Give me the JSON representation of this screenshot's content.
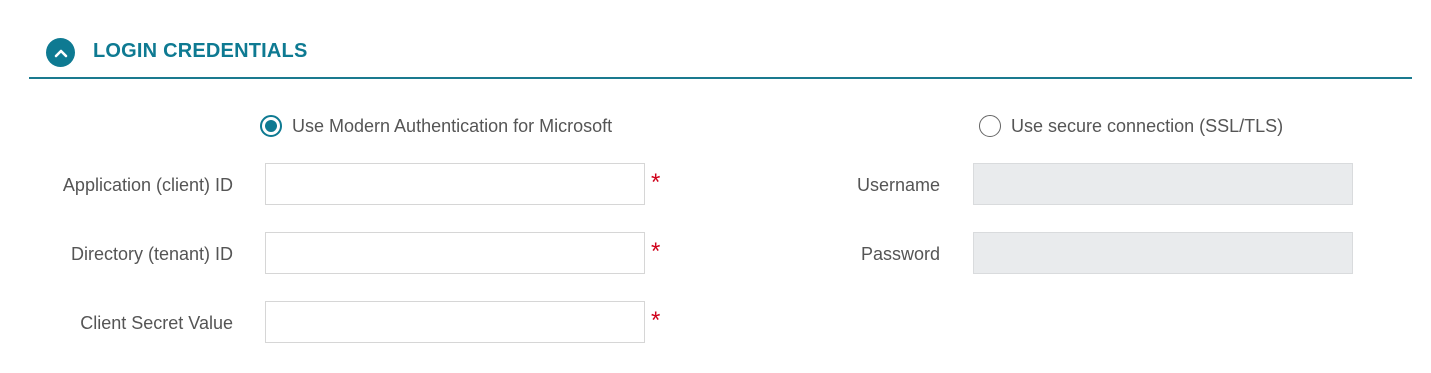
{
  "section": {
    "title": "LOGIN CREDENTIALS",
    "collapse_icon": "chevron-up-icon",
    "accent_color": "#0e7a92"
  },
  "auth_options": {
    "modern": {
      "label": "Use Modern Authentication for Microsoft",
      "checked": true
    },
    "ssl": {
      "label": "Use secure connection (SSL/TLS)",
      "checked": false
    }
  },
  "left_fields": [
    {
      "label": "Application (client) ID",
      "value": "",
      "required": true,
      "required_mark": "*"
    },
    {
      "label": "Directory (tenant) ID",
      "value": "",
      "required": true,
      "required_mark": "*"
    },
    {
      "label": "Client Secret Value",
      "value": "",
      "required": true,
      "required_mark": "*"
    }
  ],
  "right_fields": [
    {
      "label": "Username",
      "value": "",
      "disabled": true
    },
    {
      "label": "Password",
      "value": "",
      "disabled": true
    }
  ],
  "colors": {
    "required": "#d0021b",
    "disabled_bg": "#e9ebed"
  }
}
